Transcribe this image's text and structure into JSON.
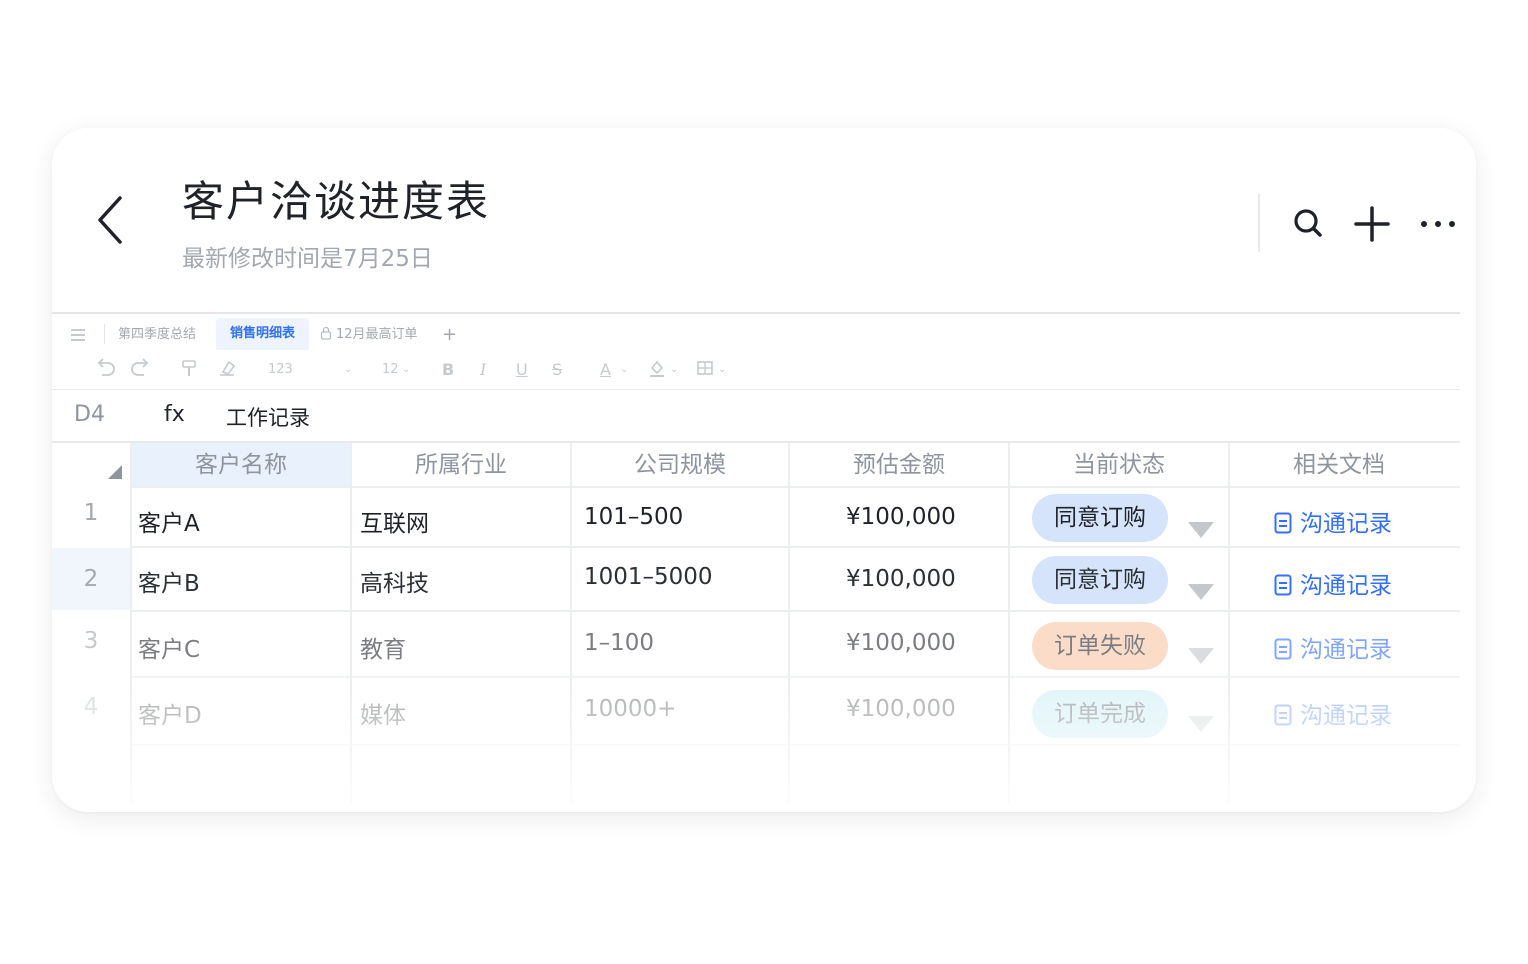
{
  "header": {
    "title": "客户洽谈进度表",
    "subtitle": "最新修改时间是7月25日"
  },
  "sheet_tabs": [
    {
      "label": "第四季度总结",
      "active": false,
      "locked": false
    },
    {
      "label": "销售明细表",
      "active": true,
      "locked": false
    },
    {
      "label": "12月最高订单",
      "active": false,
      "locked": true
    }
  ],
  "toolbar": {
    "number_format": "123",
    "font_size": "12",
    "bold": "B",
    "italic": "I",
    "underline": "U",
    "strike": "S",
    "font_color": "A"
  },
  "formula_bar": {
    "cell_ref": "D4",
    "fx": "fx",
    "value": "工作记录"
  },
  "table": {
    "columns": [
      "客户名称",
      "所属行业",
      "公司规模",
      "预估金额",
      "当前状态",
      "相关文档"
    ],
    "rows": [
      {
        "num": "1",
        "name": "客户A",
        "industry": "互联网",
        "size": "101–500",
        "amount": "¥100,000",
        "status": "同意订购",
        "doc": "沟通记录"
      },
      {
        "num": "2",
        "name": "客户B",
        "industry": "高科技",
        "size": "1001–5000",
        "amount": "¥100,000",
        "status": "同意订购",
        "doc": "沟通记录"
      },
      {
        "num": "3",
        "name": "客户C",
        "industry": "教育",
        "size": "1–100",
        "amount": "¥100,000",
        "status": "订单失败",
        "doc": "沟通记录"
      },
      {
        "num": "4",
        "name": "客户D",
        "industry": "媒体",
        "size": "10000+",
        "amount": "¥100,000",
        "status": "订单完成",
        "doc": "沟通记录"
      }
    ]
  },
  "colors": {
    "accent_blue": "#3370ff",
    "status_agree_bg": "#d6e4fb",
    "status_fail_bg": "#fbe3d4",
    "status_done_bg": "#d7f2f7"
  }
}
